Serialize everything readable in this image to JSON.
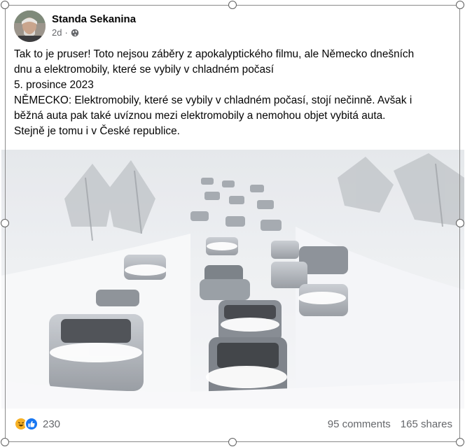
{
  "post": {
    "author": "Standa Sekanina",
    "time": "2d",
    "dot": "·",
    "privacy_icon": "globe-icon",
    "lines": [
      "Tak to je pruser! Toto nejsou záběry z apokalyptického filmu, ale Německo dnešních",
      "dnu a elektromobily, které se vybily v chladném počasí",
      "5. prosince 2023",
      "NĚMECKO: Elektromobily, které se vybily v chladném počasí, stojí nečinně. Avšak i",
      "běžná auta pak také uvíznou mezi elektromobily a nemohou objet vybitá auta.",
      "Stejně je tomu i v České republice."
    ],
    "image_alt": "Snowbound highway with cars stuck in heavy snow"
  },
  "footer": {
    "reaction_icons": [
      "haha-icon",
      "like-icon"
    ],
    "reaction_count": "230",
    "comments": "95 comments",
    "shares": "165 shares"
  },
  "colors": {
    "text": "#050505",
    "secondary": "#65676b",
    "like": "#1877f2",
    "haha": "#f7b125"
  }
}
